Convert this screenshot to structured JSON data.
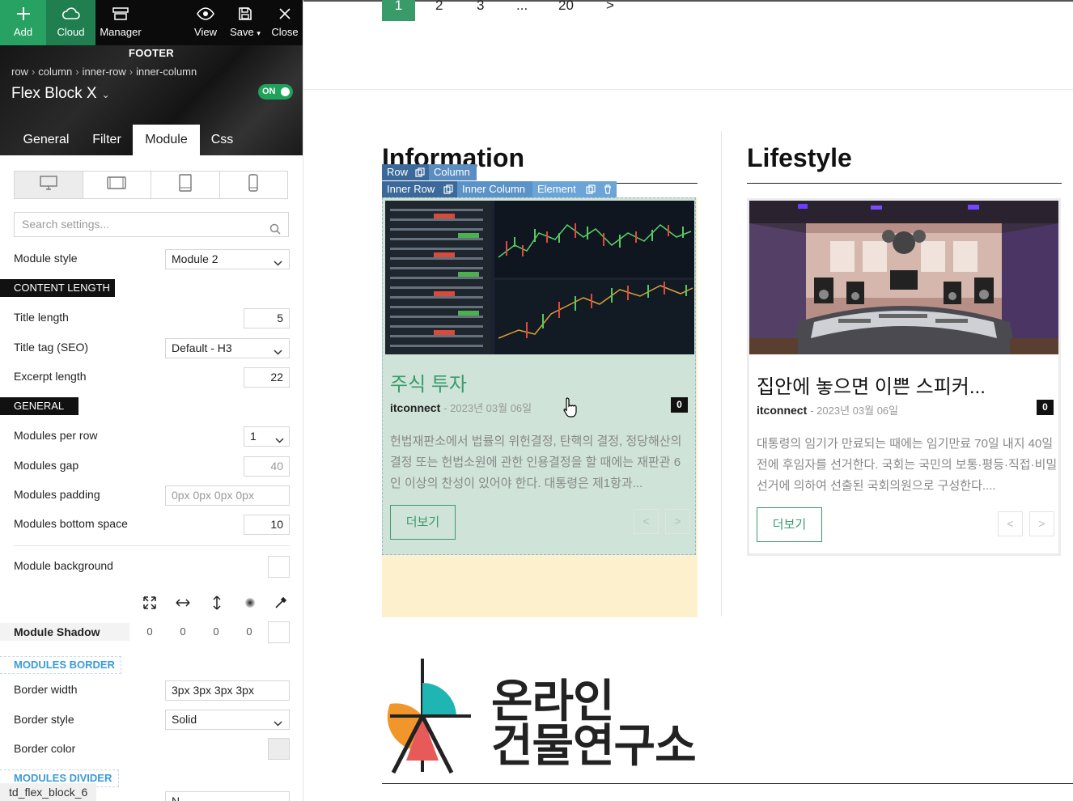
{
  "toolbar": {
    "add": "Add",
    "cloud": "Cloud",
    "manager": "Manager",
    "view": "View",
    "save": "Save",
    "close": "Close"
  },
  "panel": {
    "footer_label": "FOOTER",
    "breadcrumbs": [
      "row",
      "column",
      "inner-row",
      "inner-column"
    ],
    "block_title": "Flex Block X",
    "toggle": "ON",
    "tabs": [
      "General",
      "Filter",
      "Module",
      "Css"
    ],
    "active_tab": "Module",
    "search_placeholder": "Search settings...",
    "module_style": {
      "label": "Module style",
      "value": "Module 2"
    },
    "content_length": "CONTENT LENGTH",
    "title_length": {
      "label": "Title length",
      "value": "5"
    },
    "title_tag": {
      "label": "Title tag (SEO)",
      "value": "Default - H3"
    },
    "excerpt_length": {
      "label": "Excerpt length",
      "value": "22"
    },
    "general": "GENERAL",
    "modules_per_row": {
      "label": "Modules per row",
      "value": "1"
    },
    "modules_gap": {
      "label": "Modules gap",
      "value": "40"
    },
    "modules_padding": {
      "label": "Modules padding",
      "value": "0px 0px 0px 0px"
    },
    "modules_bottom_space": {
      "label": "Modules bottom space",
      "value": "10"
    },
    "module_background": {
      "label": "Module background"
    },
    "module_shadow": {
      "label": "Module Shadow",
      "values": [
        "0",
        "0",
        "0",
        "0"
      ]
    },
    "modules_border": "MODULES BORDER",
    "border_width": {
      "label": "Border width",
      "value": "3px 3px 3px 3px"
    },
    "border_style": {
      "label": "Border style",
      "value": "Solid"
    },
    "border_color": {
      "label": "Border color"
    },
    "modules_divider": "MODULES DIVIDER",
    "divider_value": "N",
    "status_tag": "td_flex_block_6"
  },
  "content": {
    "pagination": [
      "1",
      "2",
      "3",
      "...",
      "20",
      ">"
    ],
    "columns": [
      {
        "title": "Information",
        "card": {
          "title": "주식 투자",
          "author": "itconnect",
          "date": "- 2023년 03월 06일",
          "comments": "0",
          "excerpt": "헌법재판소에서 법률의 위헌결정, 탄핵의 결정, 정당해산의 결정 또는 헌법소원에 관한 인용결정을 할 때에는 재판관 6인 이상의 찬성이 있어야 한다. 대통령은 제1항과...",
          "more": "더보기",
          "prev": "<",
          "next": ">"
        }
      },
      {
        "title": "Lifestyle",
        "card": {
          "title": "집안에 놓으면 이쁜 스피커...",
          "author": "itconnect",
          "date": "- 2023년 03월 06일",
          "comments": "0",
          "excerpt": "대통령의 임기가 만료되는 때에는 임기만료 70일 내지 40일전에 후임자를 선거한다. 국회는 국민의 보통·평등·직접·비밀선거에 의하여 선출된 국회의원으로 구성한다....",
          "more": "더보기",
          "prev": "<",
          "next": ">"
        }
      }
    ],
    "overlay": {
      "row": "Row",
      "column": "Column",
      "inner_row": "Inner Row",
      "inner_column": "Inner Column",
      "element": "Element"
    },
    "logo": {
      "line1": "온라인",
      "line2": "건물연구소"
    }
  },
  "colors": {
    "accent_green": "#28a263",
    "card_highlight": "#cfe3d8",
    "overlay_dark": "#3b6a9a",
    "overlay_light": "#5b93c8"
  }
}
